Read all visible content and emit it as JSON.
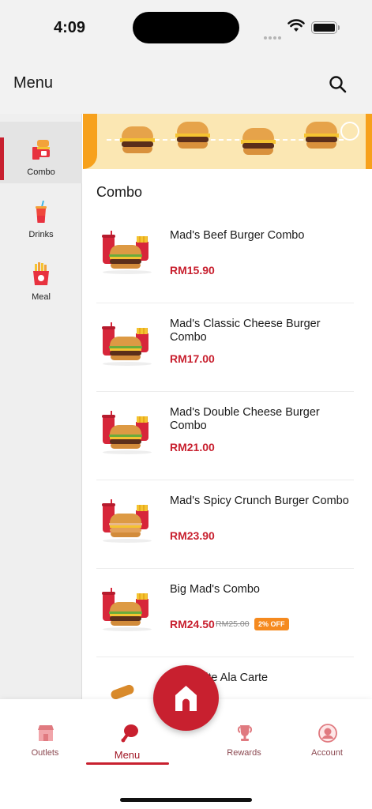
{
  "status_bar": {
    "time": "4:09"
  },
  "header": {
    "title": "Menu",
    "search_icon": "search-icon"
  },
  "sidebar": {
    "items": [
      {
        "label": "Combo",
        "icon": "combo-icon",
        "active": true
      },
      {
        "label": "Drinks",
        "icon": "drink-icon",
        "active": false
      },
      {
        "label": "Meal",
        "icon": "fries-icon",
        "active": false
      }
    ]
  },
  "content": {
    "section_title": "Combo",
    "items": [
      {
        "name": "Mad's Beef Burger Combo",
        "price": "RM15.90"
      },
      {
        "name": "Mad's Classic Cheese Burger Combo",
        "price": "RM17.00"
      },
      {
        "name": "Mad's Double Cheese Burger Combo",
        "price": "RM21.00"
      },
      {
        "name": "Mad's Spicy Crunch Burger Combo",
        "price": "RM23.90"
      },
      {
        "name": "Big Mad's Combo",
        "price": "RM24.50",
        "old_price": "RM25.00",
        "badge": "2% OFF"
      },
      {
        "name": "Favourite Ala Carte",
        "price": ""
      }
    ]
  },
  "bottom_nav": {
    "items": [
      {
        "label": "Outlets",
        "icon": "store-icon"
      },
      {
        "label": "Menu",
        "icon": "chicken-icon",
        "active": true
      },
      {
        "label": "Rewards",
        "icon": "trophy-icon"
      },
      {
        "label": "Account",
        "icon": "account-icon"
      }
    ],
    "fab_icon": "home-icon"
  },
  "colors": {
    "brand_red": "#c8202f",
    "badge_orange": "#f58a1f",
    "sidebar_bg": "#efefef"
  }
}
